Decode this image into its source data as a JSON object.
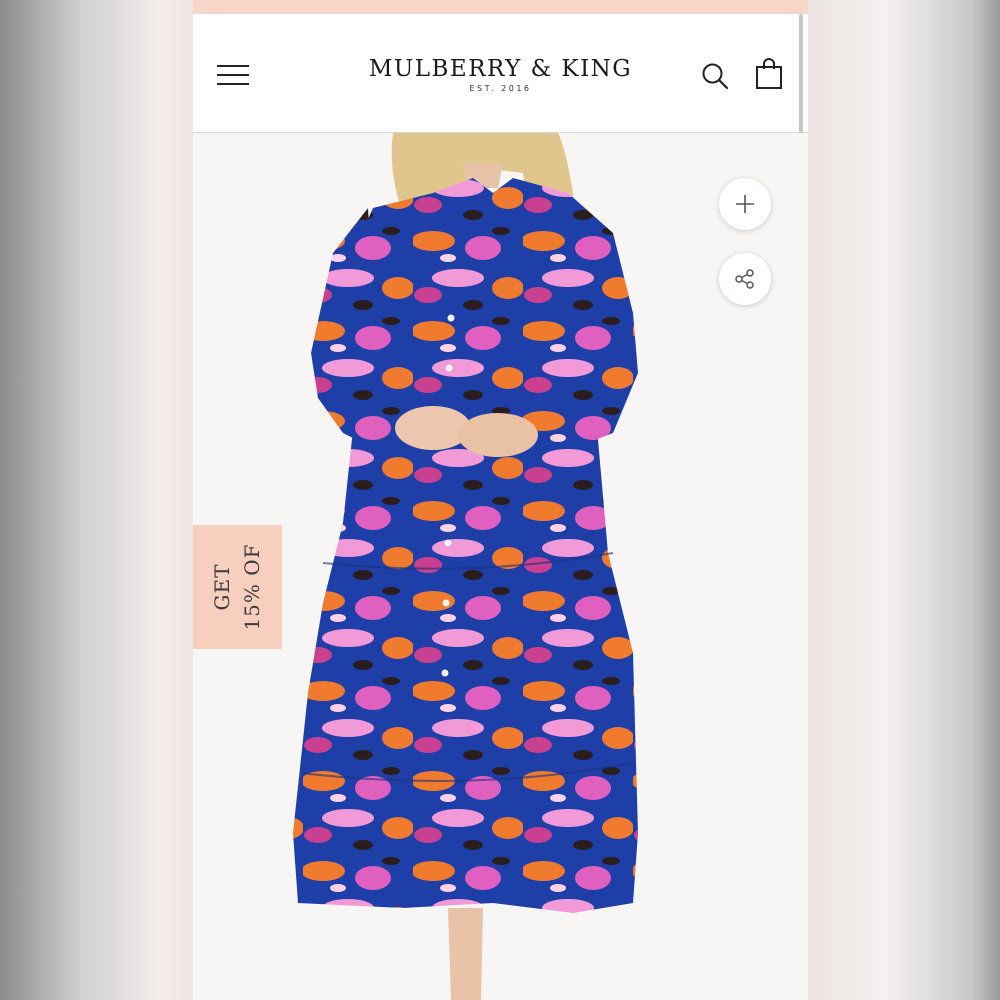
{
  "header": {
    "brand_name": "MULBERRY & KING",
    "brand_est": "EST. 2016",
    "menu_icon": "hamburger-menu-icon",
    "search_icon": "search-icon",
    "cart_icon": "shopping-bag-icon"
  },
  "product_image": {
    "description_icon": "product-photo"
  },
  "actions": {
    "zoom_icon": "plus-icon",
    "share_icon": "share-icon"
  },
  "discount_tab": {
    "line1": "GET",
    "line2": "15% OF"
  },
  "colors": {
    "promo_strip": "#f7d5c7",
    "discount_tab": "#f6cfbf",
    "dress_blue": "#1f3fa8",
    "dress_orange": "#f07a2e",
    "dress_pink": "#e060c0"
  }
}
